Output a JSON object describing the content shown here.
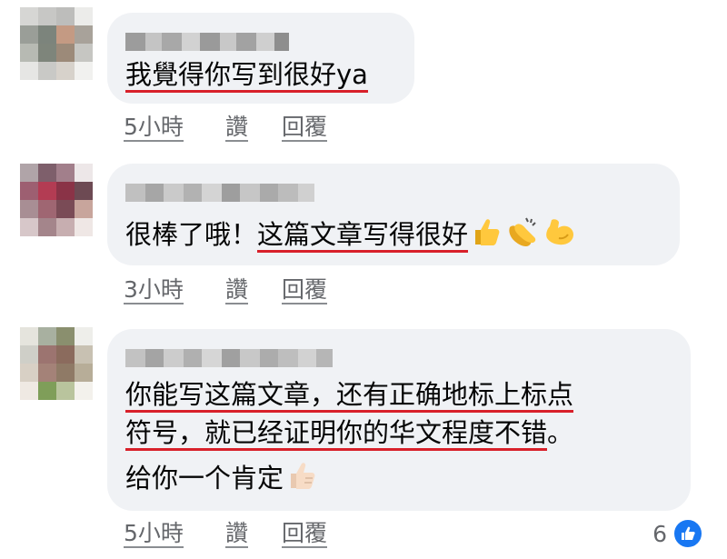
{
  "comments": [
    {
      "lines": [
        "我覺得你写到很好ya"
      ],
      "time": "5小時",
      "like": "讚",
      "reply": "回覆"
    },
    {
      "lines_plain": "很棒了哦！",
      "lines_underlined": "这篇文章写得很好",
      "emojis": [
        "thumbs-up",
        "clapping-hands",
        "flexed-biceps"
      ],
      "time": "3小時",
      "like": "讚",
      "reply": "回覆"
    },
    {
      "line1": "你能写这篇文章，还有正确地标上标点",
      "line2_underlined": "符号，就已经证明你的华文程度不错",
      "line2_tail": "。",
      "line3": "给你一个肯定",
      "emoji": "thumbs-up-light",
      "time": "5小時",
      "like": "讚",
      "reply": "回覆"
    }
  ],
  "reaction_count": "6",
  "colors": {
    "bubble": "#f0f2f5",
    "underline": "#d8202a",
    "meta": "#65676b",
    "like": "#1877f2"
  }
}
